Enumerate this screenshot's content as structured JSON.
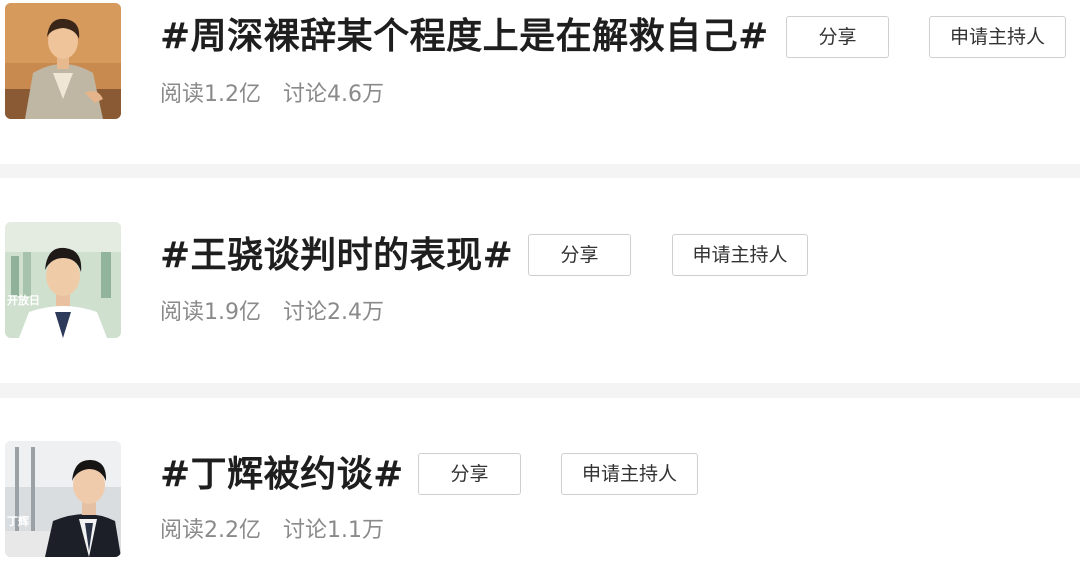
{
  "topics": [
    {
      "title": "#周深裸辞某个程度上是在解救自己#",
      "reads": "阅读1.2亿",
      "discuss": "讨论4.6万",
      "share_label": "分享",
      "host_label": "申请主持人",
      "thumb_icon": "person-portrait"
    },
    {
      "title": "#王骁谈判时的表现#",
      "reads": "阅读1.9亿",
      "discuss": "讨论2.4万",
      "share_label": "分享",
      "host_label": "申请主持人",
      "thumb_icon": "person-portrait",
      "thumb_caption": "开放日"
    },
    {
      "title": "#丁辉被约谈#",
      "reads": "阅读2.2亿",
      "discuss": "讨论1.1万",
      "share_label": "分享",
      "host_label": "申请主持人",
      "thumb_icon": "person-portrait",
      "thumb_caption": "丁辉"
    }
  ]
}
